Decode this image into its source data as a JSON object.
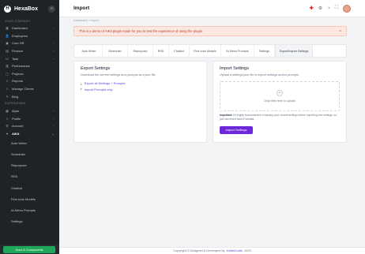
{
  "brand": {
    "logo_letter": "H",
    "name": "HexaBox",
    "toggle_glyph": "«"
  },
  "sidebar": {
    "sections": [
      {
        "title": "YOUR COMPANY",
        "items": [
          {
            "label": "Dashboard",
            "icon": "grid-icon",
            "glyph": "▦",
            "chevron": true
          },
          {
            "label": "Employees",
            "icon": "users-icon",
            "glyph": "👤",
            "chevron": false
          },
          {
            "label": "Core HR",
            "icon": "briefcase-icon",
            "glyph": "▣",
            "chevron": true
          },
          {
            "label": "Finance",
            "icon": "wallet-icon",
            "glyph": "▤",
            "chevron": true
          },
          {
            "label": "Task",
            "icon": "check-icon",
            "glyph": "☑",
            "chevron": true
          },
          {
            "label": "Performance",
            "icon": "chart-icon",
            "glyph": "▥",
            "chevron": false
          },
          {
            "label": "Projects",
            "icon": "folder-icon",
            "glyph": "▢",
            "chevron": false
          },
          {
            "label": "Reports",
            "icon": "report-icon",
            "glyph": "≡",
            "chevron": false
          },
          {
            "label": "Manage Clients",
            "icon": "client-icon",
            "glyph": "☺",
            "chevron": false
          },
          {
            "label": "Blog",
            "icon": "blog-icon",
            "glyph": "✎",
            "chevron": false
          }
        ]
      },
      {
        "title": "SUPERADMIN",
        "items": [
          {
            "label": "Apps",
            "icon": "apps-icon",
            "glyph": "▦",
            "chevron": true
          },
          {
            "label": "Profile",
            "icon": "profile-icon",
            "glyph": "☺",
            "chevron": true
          },
          {
            "label": "Account",
            "icon": "account-icon",
            "glyph": "⚙",
            "chevron": true
          },
          {
            "label": "AIKit",
            "icon": "aikit-icon",
            "glyph": "✦",
            "chevron": true,
            "active": true
          }
        ]
      }
    ],
    "sub_items": [
      "Auto Writer",
      "Scheduler",
      "Repurpose",
      "RSS",
      "Chatbot",
      "Fine-tune Models",
      "AI Menu Prompts",
      "Settings"
    ],
    "cta_label": "Docs & Components"
  },
  "topbar": {
    "title": "Import"
  },
  "breadcrumb": "Dashboard  >  Import",
  "alert": {
    "text": "This is a demo of AIKit plugin made for you to test the experience of using the plugin.",
    "close": "×"
  },
  "tabs": [
    "Auto Writer",
    "Scheduler",
    "Repurpose",
    "RSS",
    "Chatbot",
    "Fine-tune Models",
    "AI Menu Prompts",
    "Settings",
    "Export/Import Settings"
  ],
  "active_tab_index": 8,
  "export_card": {
    "title": "Export Settings",
    "desc": "Download the current settings and prompts as a json file.",
    "links": [
      "Export all Settings + Prompts",
      "Import Prompts only"
    ]
  },
  "import_card": {
    "title": "Import Settings",
    "desc": "Upload a settings json file to import settings and/or prompts.",
    "dropzone_text": "Drop files here to upload",
    "note_label": "Important:",
    "note_text": " It's highly recommended to backup your current settings before importing new settings, so you can revert back if needed.",
    "button_label": "Import Settings"
  },
  "footer": {
    "prefix": "Copyright © Designed & Developed by",
    "link": "IndianCoder",
    "year": "2023"
  },
  "colors": {
    "primary": "#6d28d9",
    "cta": "#1fa85a",
    "sidebar_bg": "#1f2326",
    "alert_bg": "#fde8e1"
  }
}
